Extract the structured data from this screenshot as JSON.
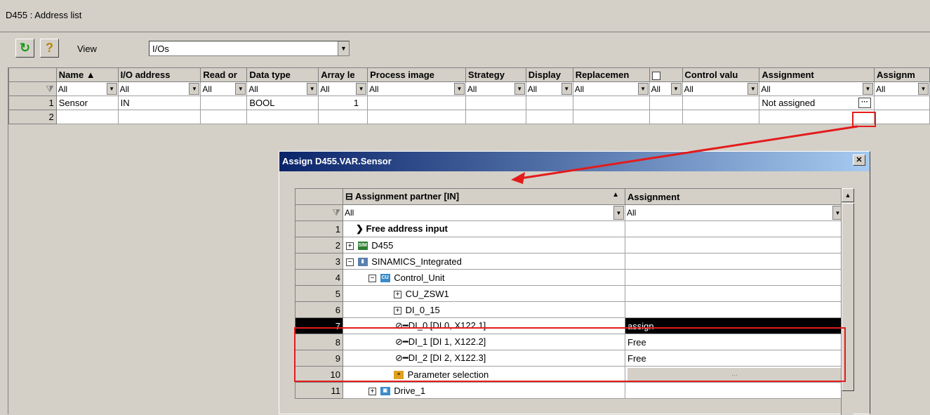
{
  "window": {
    "title": "D455 : Address list"
  },
  "toolbar": {
    "refresh_icon": "refresh-icon",
    "help_icon": "help-icon",
    "view_label": "View",
    "view_value": "I/Os"
  },
  "grid": {
    "columns": [
      "Name",
      "I/O address",
      "Read or",
      "Data type",
      "Array le",
      "Process image",
      "Strategy",
      "Display",
      "Replacemen",
      "",
      "Control valu",
      "Assignment",
      "Assignm"
    ],
    "filter_value": "All",
    "rows": [
      {
        "num": "1",
        "name": "Sensor",
        "io": "IN",
        "read": "",
        "type": "BOOL",
        "array": "1",
        "assignment": "Not assigned"
      },
      {
        "num": "2",
        "name": "",
        "io": "",
        "read": "",
        "type": "",
        "array": "",
        "assignment": ""
      }
    ]
  },
  "dialog": {
    "title": "Assign D455.VAR.Sensor",
    "col_partner": "Assignment partner [IN]",
    "col_assignment": "Assignment",
    "filter_value": "All",
    "rows": [
      {
        "num": "1",
        "label": "Free address input",
        "assignment": ""
      },
      {
        "num": "2",
        "label": "D455",
        "assignment": ""
      },
      {
        "num": "3",
        "label": "SINAMICS_Integrated",
        "assignment": ""
      },
      {
        "num": "4",
        "label": "Control_Unit",
        "assignment": ""
      },
      {
        "num": "5",
        "label": "CU_ZSW1",
        "assignment": ""
      },
      {
        "num": "6",
        "label": "DI_0_15",
        "assignment": ""
      },
      {
        "num": "7",
        "label": "DI_0 [DI 0, X122.1]",
        "assignment": "assign"
      },
      {
        "num": "8",
        "label": "DI_1 [DI 1, X122.2]",
        "assignment": "Free"
      },
      {
        "num": "9",
        "label": "DI_2 [DI 2, X122.3]",
        "assignment": "Free"
      },
      {
        "num": "10",
        "label": "Parameter selection",
        "assignment": "..."
      },
      {
        "num": "11",
        "label": "Drive_1",
        "assignment": ""
      }
    ]
  },
  "colors": {
    "annotation": "#e31b1b",
    "title_bar": "#0a246a",
    "selection": "#000000"
  }
}
